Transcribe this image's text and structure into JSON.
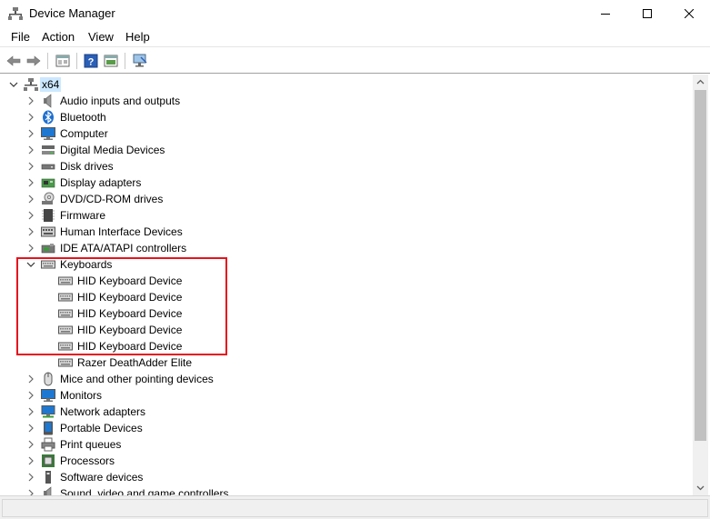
{
  "window": {
    "title": "Device Manager",
    "controls": [
      "minimize",
      "maximize",
      "close"
    ]
  },
  "menu": {
    "items": [
      "File",
      "Action",
      "View",
      "Help"
    ]
  },
  "toolbar": {
    "buttons": [
      "back-icon",
      "forward-icon",
      "properties-icon",
      "help-icon",
      "show-hide-icon",
      "scan-hardware-icon"
    ]
  },
  "tree": {
    "root": {
      "label": "x64",
      "expanded": true,
      "selected": true
    },
    "categories": [
      {
        "label": "Audio inputs and outputs",
        "icon": "speaker-icon",
        "expanded": false
      },
      {
        "label": "Bluetooth",
        "icon": "bluetooth-icon",
        "expanded": false
      },
      {
        "label": "Computer",
        "icon": "computer-icon",
        "expanded": false
      },
      {
        "label": "Digital Media Devices",
        "icon": "media-device-icon",
        "expanded": false
      },
      {
        "label": "Disk drives",
        "icon": "disk-drive-icon",
        "expanded": false
      },
      {
        "label": "Display adapters",
        "icon": "display-adapter-icon",
        "expanded": false
      },
      {
        "label": "DVD/CD-ROM drives",
        "icon": "dvd-icon",
        "expanded": false
      },
      {
        "label": "Firmware",
        "icon": "firmware-icon",
        "expanded": false
      },
      {
        "label": "Human Interface Devices",
        "icon": "hid-icon",
        "expanded": false
      },
      {
        "label": "IDE ATA/ATAPI controllers",
        "icon": "ide-controller-icon",
        "expanded": false
      },
      {
        "label": "Keyboards",
        "icon": "keyboard-icon",
        "expanded": true,
        "children": [
          "HID Keyboard Device",
          "HID Keyboard Device",
          "HID Keyboard Device",
          "HID Keyboard Device",
          "HID Keyboard Device",
          "Razer DeathAdder Elite"
        ]
      },
      {
        "label": "Mice and other pointing devices",
        "icon": "mouse-icon",
        "expanded": false
      },
      {
        "label": "Monitors",
        "icon": "monitor-icon",
        "expanded": false
      },
      {
        "label": "Network adapters",
        "icon": "network-adapter-icon",
        "expanded": false
      },
      {
        "label": "Portable Devices",
        "icon": "portable-device-icon",
        "expanded": false
      },
      {
        "label": "Print queues",
        "icon": "printer-icon",
        "expanded": false
      },
      {
        "label": "Processors",
        "icon": "processor-icon",
        "expanded": false
      },
      {
        "label": "Software devices",
        "icon": "software-device-icon",
        "expanded": false
      },
      {
        "label": "Sound, video and game controllers",
        "icon": "sound-controller-icon",
        "expanded": false
      }
    ]
  },
  "colors": {
    "selection": "#cce8ff",
    "highlight_box": "#e5141e",
    "monitor_blue": "#1e78d2"
  }
}
